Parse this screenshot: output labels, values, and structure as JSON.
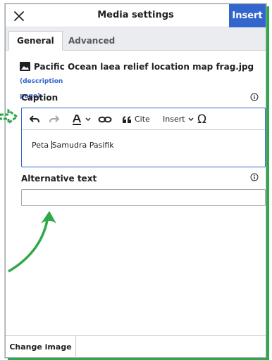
{
  "header": {
    "title": "Media settings",
    "insert_label": "Insert"
  },
  "tabs": [
    {
      "label": "General",
      "active": true
    },
    {
      "label": "Advanced",
      "active": false
    }
  ],
  "file": {
    "name": "Pacific Ocean laea relief location map frag.jpg",
    "link_open": "(description",
    "link_close": "page)"
  },
  "caption": {
    "label": "Caption",
    "value_before_cursor": "Peta ",
    "value_after_cursor": "Samudra Pasifik"
  },
  "toolbar": {
    "cite_label": "Cite",
    "insert_label": "Insert"
  },
  "alt_text": {
    "label": "Alternative text",
    "value": ""
  },
  "footer": {
    "change_image_label": "Change image"
  },
  "colors": {
    "accent": "#3366cc",
    "annotation": "#2fa84a"
  }
}
